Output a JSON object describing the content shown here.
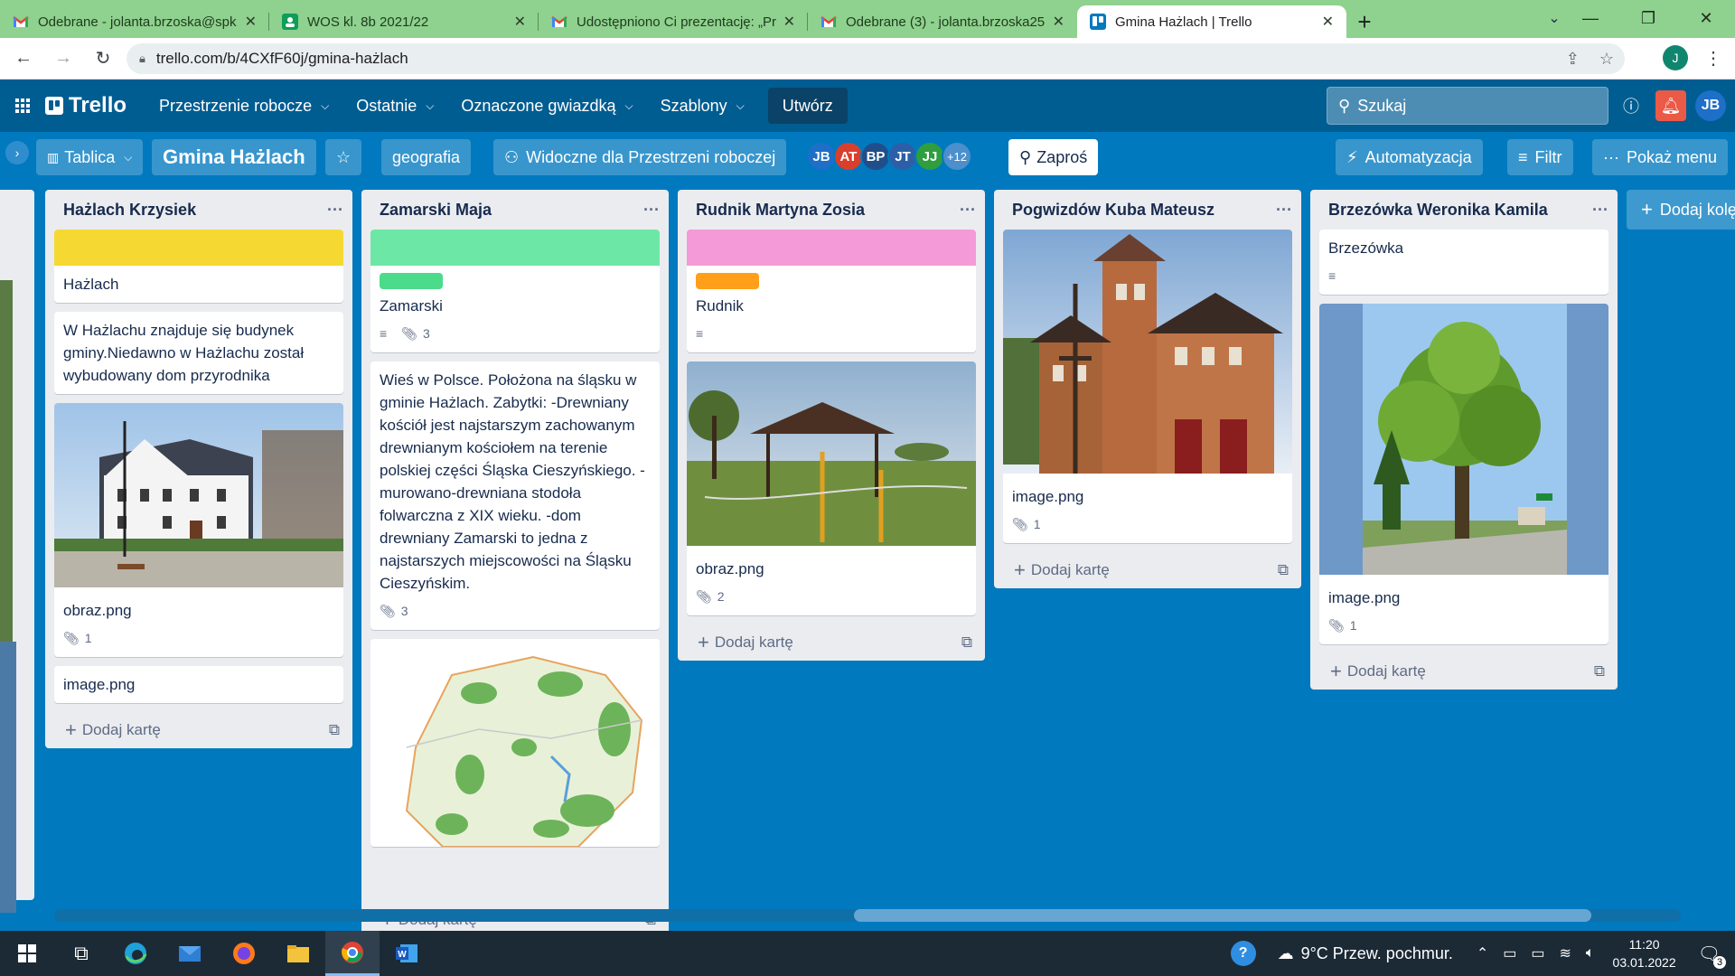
{
  "browser": {
    "tabs": [
      {
        "title": "Odebrane - jolanta.brzoska@spk",
        "icon": "gmail-icon"
      },
      {
        "title": "WOS kl. 8b 2021/22",
        "icon": "classroom-icon"
      },
      {
        "title": "Udostępniono Ci prezentację: „Pr",
        "icon": "gmail-icon"
      },
      {
        "title": "Odebrane (3) - jolanta.brzoska25",
        "icon": "gmail-icon"
      },
      {
        "title": "Gmina Hażlach | Trello",
        "icon": "trello-icon"
      }
    ],
    "url": "trello.com/b/4CXfF60j/gmina-hażlach",
    "profile_letter": "J"
  },
  "trello": {
    "logo": "Trello",
    "menus": [
      "Przestrzenie robocze",
      "Ostatnie",
      "Oznaczone gwiazdką",
      "Szablony"
    ],
    "create": "Utwórz",
    "search_placeholder": "Szukaj",
    "user_initials": "JB"
  },
  "board": {
    "view": "Tablica",
    "title": "Gmina Hażlach",
    "workspace": "geografia",
    "visibility": "Widoczne dla Przestrzeni roboczej",
    "members": [
      {
        "initials": "JB",
        "color": "#1d6fc7"
      },
      {
        "initials": "AT",
        "color": "#d93f2c"
      },
      {
        "initials": "BP",
        "color": "#1f4e8a"
      },
      {
        "initials": "JT",
        "color": "#2d5fa8"
      },
      {
        "initials": "JJ",
        "color": "#2e9e3e"
      }
    ],
    "more_members": "+12",
    "invite": "Zaproś",
    "automation": "Automatyzacja",
    "filter": "Filtr",
    "show_menu": "Pokaż menu",
    "add_list": "Dodaj kolę"
  },
  "lists": [
    {
      "title": "Hażlach Krzysiek",
      "cover_color": "#f5d932",
      "cover_title": "Hażlach",
      "text_card": "W Hażlachu znajduje się budynek gminy.Niedawno w Hażlachu został wybudowany dom przyrodnika",
      "image_name": "obraz.png",
      "image_attach": "1",
      "extra_card": "image.png",
      "add": "Dodaj kartę"
    },
    {
      "title": "Zamarski Maja",
      "cover_color": "#6de7a5",
      "label_color": "#4bdb8a",
      "cover_title": "Zamarski",
      "cover_attach": "3",
      "text_card": "Wieś w Polsce. Położona na śląsku w gminie Hażlach. Zabytki: -Drewniany kościół jest najstarszym zachowanym drewnianym kościołem na terenie polskiej części Śląska Cieszyńskiego. -murowano-drewniana stodoła folwarczna z XIX wieku. -dom drewniany Zamarski to jedna z najstarszych miejscowości na Śląsku Cieszyńskim.",
      "text_attach": "3",
      "add": "Dodaj kartę"
    },
    {
      "title": "Rudnik Martyna Zosia",
      "cover_color": "#f59ad8",
      "label_color": "#ff9f1a",
      "cover_title": "Rudnik",
      "image_name": "obraz.png",
      "image_attach": "2",
      "add": "Dodaj kartę"
    },
    {
      "title": "Pogwizdów Kuba Mateusz",
      "image_name": "image.png",
      "image_attach": "1",
      "add": "Dodaj kartę"
    },
    {
      "title": "Brzezówka Weronika Kamila",
      "cover_title": "Brzezówka",
      "image_name": "image.png",
      "image_attach": "1",
      "add": "Dodaj kartę"
    }
  ],
  "taskbar": {
    "weather": "9°C  Przew. pochmur.",
    "time": "11:20",
    "date": "03.01.2022",
    "notifications": "3"
  }
}
